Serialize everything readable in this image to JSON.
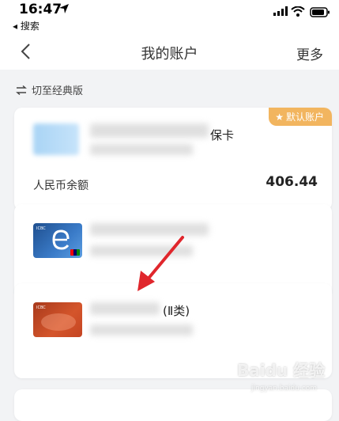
{
  "status_bar": {
    "time": "16:47",
    "back_app": "◂ 搜索"
  },
  "nav": {
    "title": "我的账户",
    "more": "更多"
  },
  "switch": {
    "label": "切至经典版"
  },
  "default_card": {
    "badge": "默认账户",
    "name_tail": "保卡",
    "balance_label": "人民币余额",
    "balance_value": "406.44"
  },
  "card3": {
    "type_tail": "(Ⅱ类)"
  },
  "watermark": {
    "text": "Baidu 经验",
    "sub": "jingyan.baidu.com"
  },
  "colors": {
    "badge": "#f2b55f",
    "arrow": "#e0262c"
  }
}
